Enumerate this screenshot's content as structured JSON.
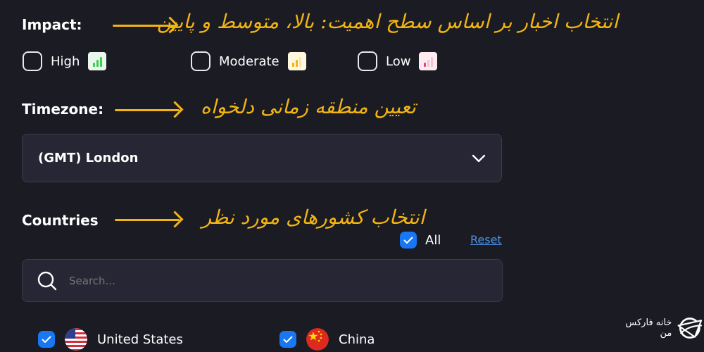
{
  "impact": {
    "label": "Impact:",
    "note": "انتخاب اخبار بر اساس سطح اهمیت: بالا، متوسط و پایین",
    "options": [
      {
        "label": "High",
        "icon": "signal-high-icon",
        "color": "#3ccf4e",
        "checked": false
      },
      {
        "label": "Moderate",
        "icon": "signal-moderate-icon",
        "color": "#f2b411",
        "checked": false
      },
      {
        "label": "Low",
        "icon": "signal-low-icon",
        "color": "#e5447a",
        "checked": false
      }
    ]
  },
  "timezone": {
    "label": "Timezone:",
    "note": "تعیین منطقه زمانی دلخواه",
    "selected": "(GMT) London",
    "icon": "chevron-down-icon"
  },
  "countries": {
    "label": "Countries",
    "note": "انتخاب کشورهای مورد نظر",
    "all_label": "All",
    "all_checked": true,
    "reset_label": "Reset",
    "search_placeholder": "Search...",
    "items": [
      {
        "label": "United States",
        "checked": true,
        "icon": "us-flag-icon"
      },
      {
        "label": "China",
        "checked": true,
        "icon": "china-flag-icon"
      }
    ]
  },
  "brand": {
    "name": "خانه فارکس من",
    "icon": "brand-logo-icon"
  },
  "colors": {
    "background": "#1b1b24",
    "field": "#262634",
    "accent": "#1877f2",
    "annotation": "#f2b411",
    "link": "#4a90e2"
  }
}
